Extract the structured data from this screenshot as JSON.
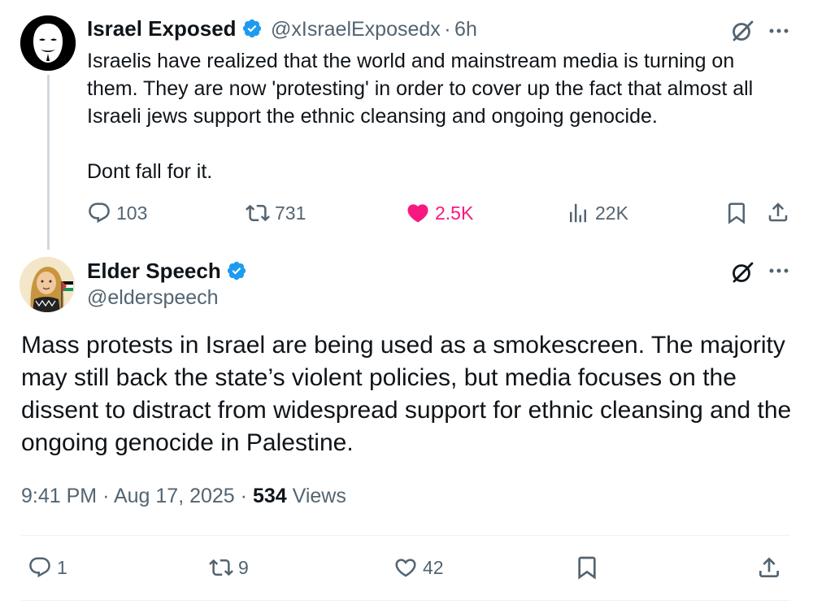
{
  "parent_tweet": {
    "author_name": "Israel Exposed",
    "handle": "@xIsraelExposedx",
    "separator": "·",
    "time": "6h",
    "text_lines": [
      "Israelis have realized that the world and mainstream media is turning on",
      "them. They are now 'protesting' in order to cover up the fact that almost all",
      "Israeli jews support the ethnic cleansing and ongoing genocide."
    ],
    "text_last": "Dont fall for it.",
    "replies": "103",
    "reposts": "731",
    "likes": "2.5K",
    "views": "22K",
    "liked": true
  },
  "main_tweet": {
    "author_name": "Elder Speech",
    "handle": "@elderspeech",
    "text_lines": [
      "Mass protests in Israel are being used as a smokescreen. The majority",
      "may still back the state’s violent policies, but media focuses on the",
      "dissent to distract from widespread support for ethnic cleansing and the",
      "ongoing genocide in Palestine."
    ],
    "time": "9:41 PM",
    "date": "Aug 17, 2025",
    "views_count": "534",
    "views_label": "Views",
    "replies": "1",
    "reposts": "9",
    "likes": "42"
  },
  "colors": {
    "text": "#0f1419",
    "secondary": "#536471",
    "verified": "#1d9bf0",
    "like_active": "#f91880",
    "divider": "#eff3f4"
  }
}
